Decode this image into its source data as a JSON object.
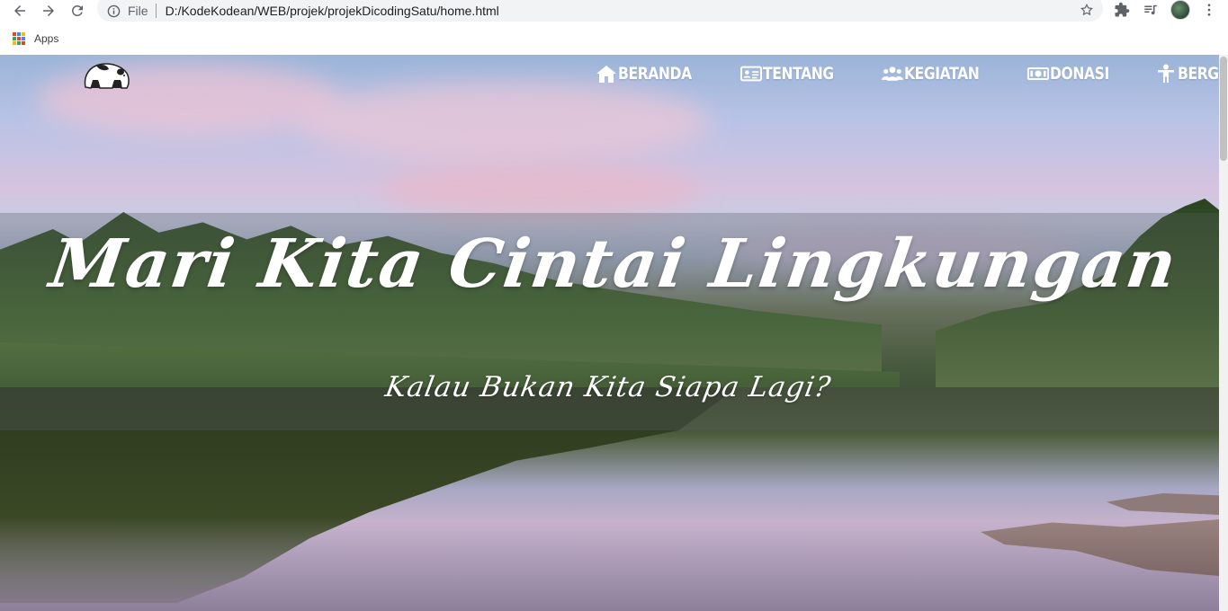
{
  "browser": {
    "scheme_label": "File",
    "url": "D:/KodeKodean/WEB/projek/projekDicodingSatu/home.html",
    "bookmarks_apps_label": "Apps"
  },
  "site": {
    "nav": [
      {
        "label": "BERANDA",
        "icon": "home-icon"
      },
      {
        "label": "TENTANG",
        "icon": "id-card-icon"
      },
      {
        "label": "KEGIATAN",
        "icon": "users-icon"
      },
      {
        "label": "DONASI",
        "icon": "money-icon"
      },
      {
        "label": "BERGABUNG",
        "icon": "person-icon"
      }
    ],
    "headline": "Mari Kita Cintai Lingkungan",
    "subheadline": "Kalau Bukan Kita Siapa Lagi?"
  },
  "colors": {
    "nav_text": "#ffffff",
    "omnibox_bg": "#f1f3f4",
    "banner_overlay": "rgba(90,90,100,0.32)"
  }
}
